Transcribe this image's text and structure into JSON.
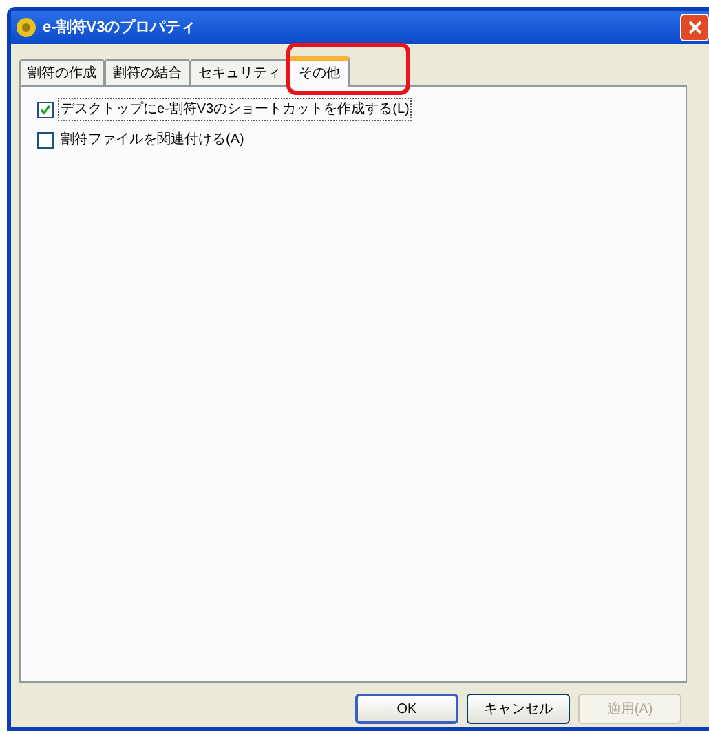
{
  "window": {
    "title": "e-割符V3のプロパティ"
  },
  "tabs": [
    {
      "label": "割符の作成",
      "selected": false
    },
    {
      "label": "割符の結合",
      "selected": false
    },
    {
      "label": "セキュリティ",
      "selected": false
    },
    {
      "label": "その他",
      "selected": true
    }
  ],
  "options": [
    {
      "label": "デスクトップにe-割符V3のショートカットを作成する(L)",
      "checked": true,
      "focused": true
    },
    {
      "label": "割符ファイルを関連付ける(A)",
      "checked": false,
      "focused": false
    }
  ],
  "buttons": [
    {
      "label": "OK",
      "disabled": false,
      "default": true
    },
    {
      "label": "キャンセル",
      "disabled": false,
      "default": false
    },
    {
      "label": "適用(A)",
      "disabled": true,
      "default": false
    }
  ]
}
